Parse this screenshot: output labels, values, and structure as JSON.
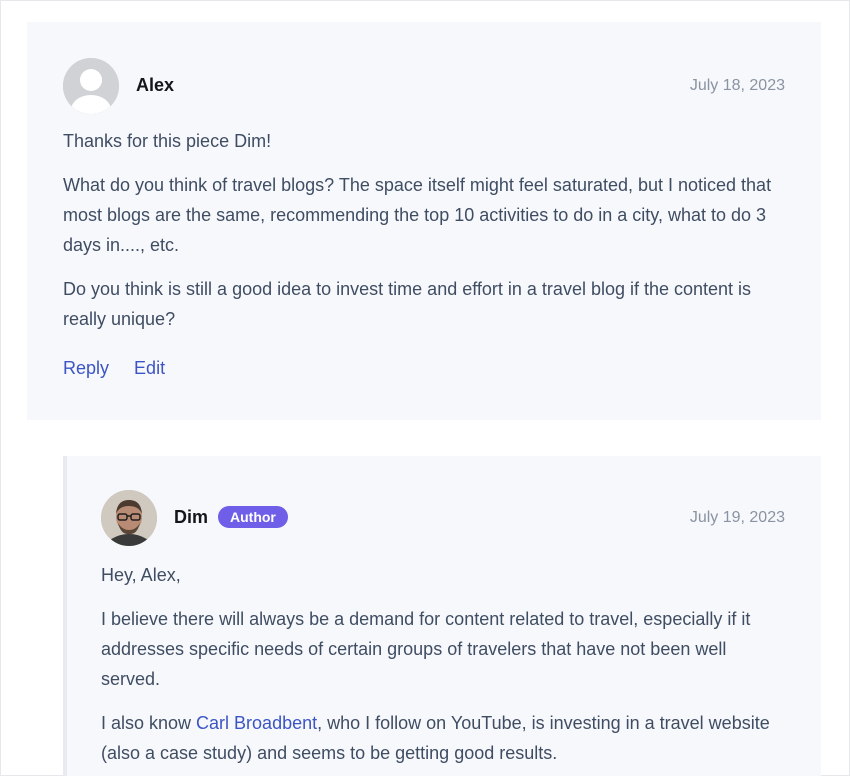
{
  "comments": [
    {
      "author": "Alex",
      "date": "July 18, 2023",
      "avatar": "default-user-avatar",
      "paragraphs": [
        "Thanks for this piece Dim!",
        "What do you think of travel blogs? The space itself might feel saturated, but I noticed that most blogs are the same, recommending the top 10 activities to do in a city, what to do 3 days in...., etc.",
        "Do you think is still a good idea to invest time and effort in a travel blog if the content is really unique?"
      ],
      "actions": {
        "reply": "Reply",
        "edit": "Edit"
      }
    }
  ],
  "reply": {
    "author": "Dim",
    "badge": "Author",
    "date": "July 19, 2023",
    "avatar": "user-photo-avatar",
    "greeting": "Hey, Alex,",
    "paragraph2": "I believe there will always be a demand for content related to travel, especially if it addresses specific needs of certain groups of travelers that have not been well served.",
    "p3_before": "I also know ",
    "p3_link": "Carl Broadbent",
    "p3_after": ", who I follow on YouTube, is investing in a travel website (also a case study) and seems to be getting good results."
  },
  "colors": {
    "badge": "#6e5ee8",
    "link": "#3b55c4",
    "card_bg": "#f7f8fb"
  }
}
